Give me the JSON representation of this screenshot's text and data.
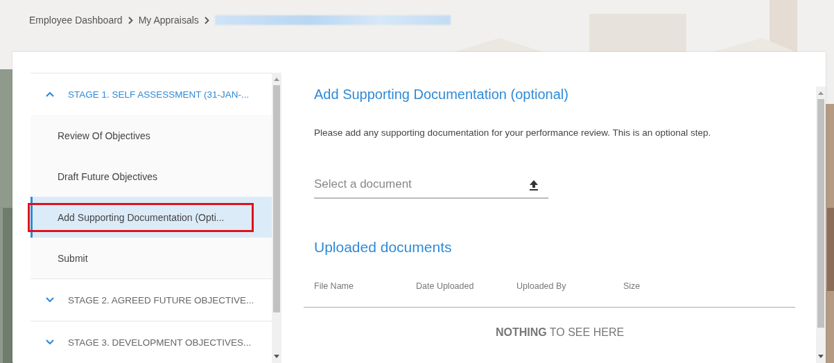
{
  "breadcrumb": {
    "items": [
      "Employee Dashboard",
      "My Appraisals"
    ],
    "redacted": true
  },
  "stages": [
    {
      "label": "STAGE 1. SELF ASSESSMENT (31-JAN-...",
      "expanded": true,
      "steps": [
        {
          "label": "Review Of Objectives",
          "selected": false,
          "annotated": false
        },
        {
          "label": "Draft Future Objectives",
          "selected": false,
          "annotated": false
        },
        {
          "label": "Add Supporting Documentation (Opti...",
          "selected": true,
          "annotated": true
        },
        {
          "label": "Submit",
          "selected": false,
          "annotated": false
        }
      ]
    },
    {
      "label": "STAGE 2. AGREED FUTURE OBJECTIVE...",
      "expanded": false
    },
    {
      "label": "STAGE 3. DEVELOPMENT OBJECTIVES...",
      "expanded": false
    }
  ],
  "content": {
    "title": "Add Supporting Documentation (optional)",
    "description": "Please add any supporting documentation for your performance review. This is an optional step.",
    "upload_field": {
      "placeholder": "Select a document"
    },
    "uploaded": {
      "title": "Uploaded documents",
      "columns": [
        "File Name",
        "Date Uploaded",
        "Uploaded By",
        "Size"
      ],
      "empty_message": "**NOTHING** TO SEE HERE"
    }
  }
}
